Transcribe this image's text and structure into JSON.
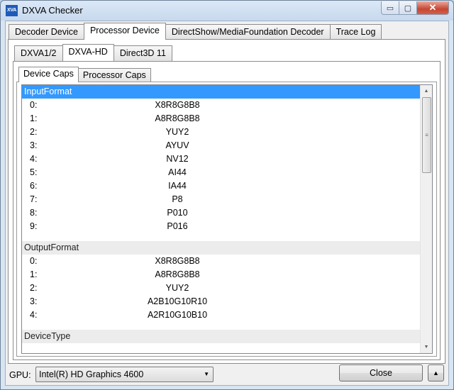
{
  "window": {
    "title": "DXVA Checker",
    "icon_text": "XVA"
  },
  "caption": {
    "minimize": "▭",
    "maximize": "▢",
    "close": "✕"
  },
  "main_tabs": [
    {
      "label": "Decoder Device",
      "active": false
    },
    {
      "label": "Processor Device",
      "active": true
    },
    {
      "label": "DirectShow/MediaFoundation Decoder",
      "active": false
    },
    {
      "label": "Trace Log",
      "active": false
    }
  ],
  "api_tabs": [
    {
      "label": "DXVA1/2",
      "active": false
    },
    {
      "label": "DXVA-HD",
      "active": true
    },
    {
      "label": "Direct3D 11",
      "active": false
    }
  ],
  "caps_tabs": [
    {
      "label": "Device Caps",
      "active": true
    },
    {
      "label": "Processor Caps",
      "active": false
    }
  ],
  "list": {
    "input_group": "InputFormat",
    "input_items": [
      {
        "idx": "0:",
        "value": "X8R8G8B8"
      },
      {
        "idx": "1:",
        "value": "A8R8G8B8"
      },
      {
        "idx": "2:",
        "value": "YUY2"
      },
      {
        "idx": "3:",
        "value": "AYUV"
      },
      {
        "idx": "4:",
        "value": "NV12"
      },
      {
        "idx": "5:",
        "value": "AI44"
      },
      {
        "idx": "6:",
        "value": "IA44"
      },
      {
        "idx": "7:",
        "value": "P8"
      },
      {
        "idx": "8:",
        "value": "P010"
      },
      {
        "idx": "9:",
        "value": "P016"
      }
    ],
    "output_group": "OutputFormat",
    "output_items": [
      {
        "idx": "0:",
        "value": "X8R8G8B8"
      },
      {
        "idx": "1:",
        "value": "A8R8G8B8"
      },
      {
        "idx": "2:",
        "value": "YUY2"
      },
      {
        "idx": "3:",
        "value": "A2B10G10R10"
      },
      {
        "idx": "4:",
        "value": "A2R10G10B10"
      }
    ],
    "next_group": "DeviceType"
  },
  "footer": {
    "gpu_label": "GPU:",
    "gpu_value": "Intel(R) HD Graphics 4600",
    "close_label": "Close",
    "up_label": "▲"
  },
  "colors": {
    "selection": "#3399ff",
    "group_bg": "#ececec"
  },
  "icons": {
    "dropdown": "chevron-down-icon",
    "scroll_up": "scroll-up-arrow-icon",
    "scroll_down": "scroll-down-arrow-icon"
  }
}
